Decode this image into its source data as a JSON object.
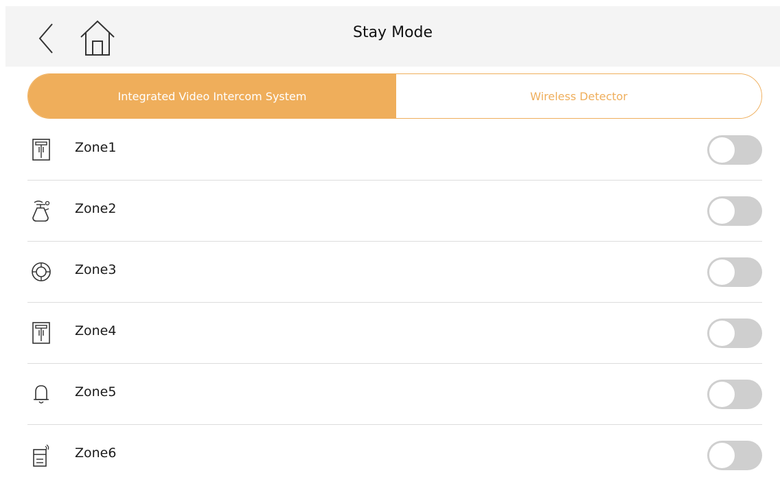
{
  "header": {
    "title": "Stay Mode",
    "back_icon": "chevron-left-icon",
    "home_icon": "home-icon"
  },
  "tabs": [
    {
      "label": "Integrated Video Intercom System",
      "active": true
    },
    {
      "label": "Wireless Detector",
      "active": false
    }
  ],
  "zones": [
    {
      "label": "Zone1",
      "icon": "door-sensor-icon",
      "enabled": false
    },
    {
      "label": "Zone2",
      "icon": "gas-detector-icon",
      "enabled": false
    },
    {
      "label": "Zone3",
      "icon": "smoke-detector-icon",
      "enabled": false
    },
    {
      "label": "Zone4",
      "icon": "door-sensor-icon",
      "enabled": false
    },
    {
      "label": "Zone5",
      "icon": "bell-icon",
      "enabled": false
    },
    {
      "label": "Zone6",
      "icon": "panic-button-icon",
      "enabled": false
    }
  ],
  "colors": {
    "accent": "#efae5b",
    "header_bg": "#f4f4f4",
    "toggle_off": "#cfcfcf",
    "divider": "#dcdcdc"
  }
}
